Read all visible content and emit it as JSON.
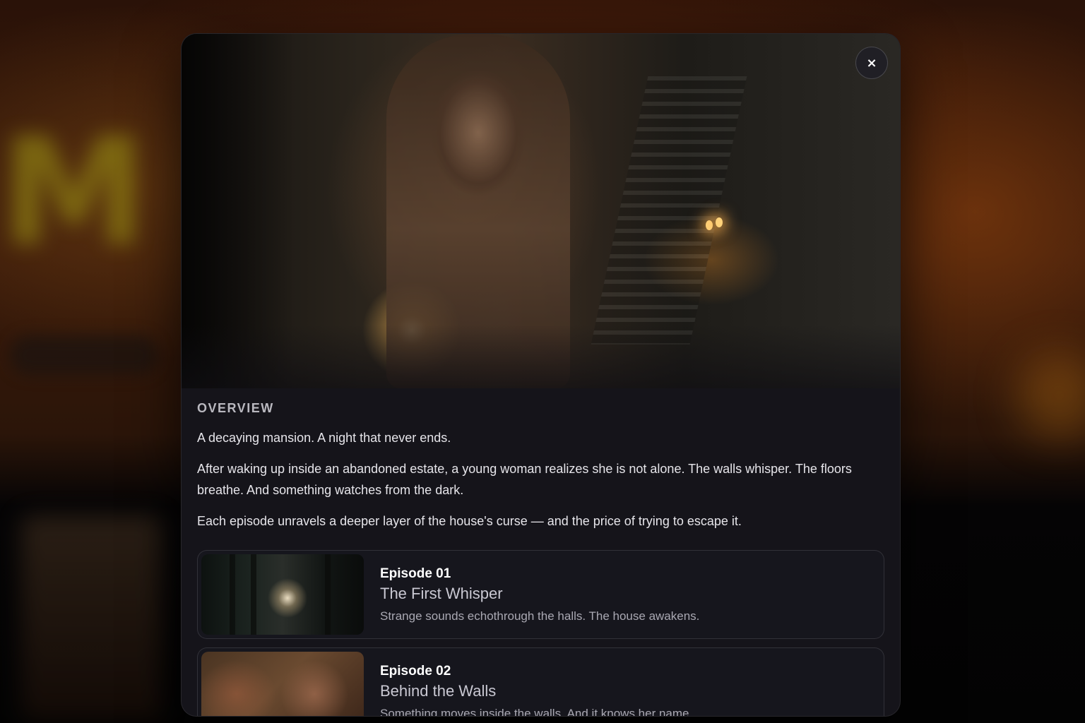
{
  "modal": {
    "close_label": "×",
    "overview_heading": "OVERVIEW",
    "overview_paragraphs": [
      "A decaying mansion. A night that never ends.",
      "After waking up inside an abandoned estate, a young woman realizes she is not alone. The walls whisper. The floors breathe. And something watches from the dark.",
      "Each episode unravels a deeper layer of the house's curse — and the price of trying to escape it."
    ],
    "episodes": [
      {
        "number": "Episode 01",
        "title": "The First Whisper",
        "description": "Strange sounds echothrough the halls. The house awakens."
      },
      {
        "number": "Episode 02",
        "title": "Behind the Walls",
        "description": "Something moves inside the walls. And it knows her name."
      }
    ]
  },
  "icons": {
    "close": "close-icon"
  }
}
